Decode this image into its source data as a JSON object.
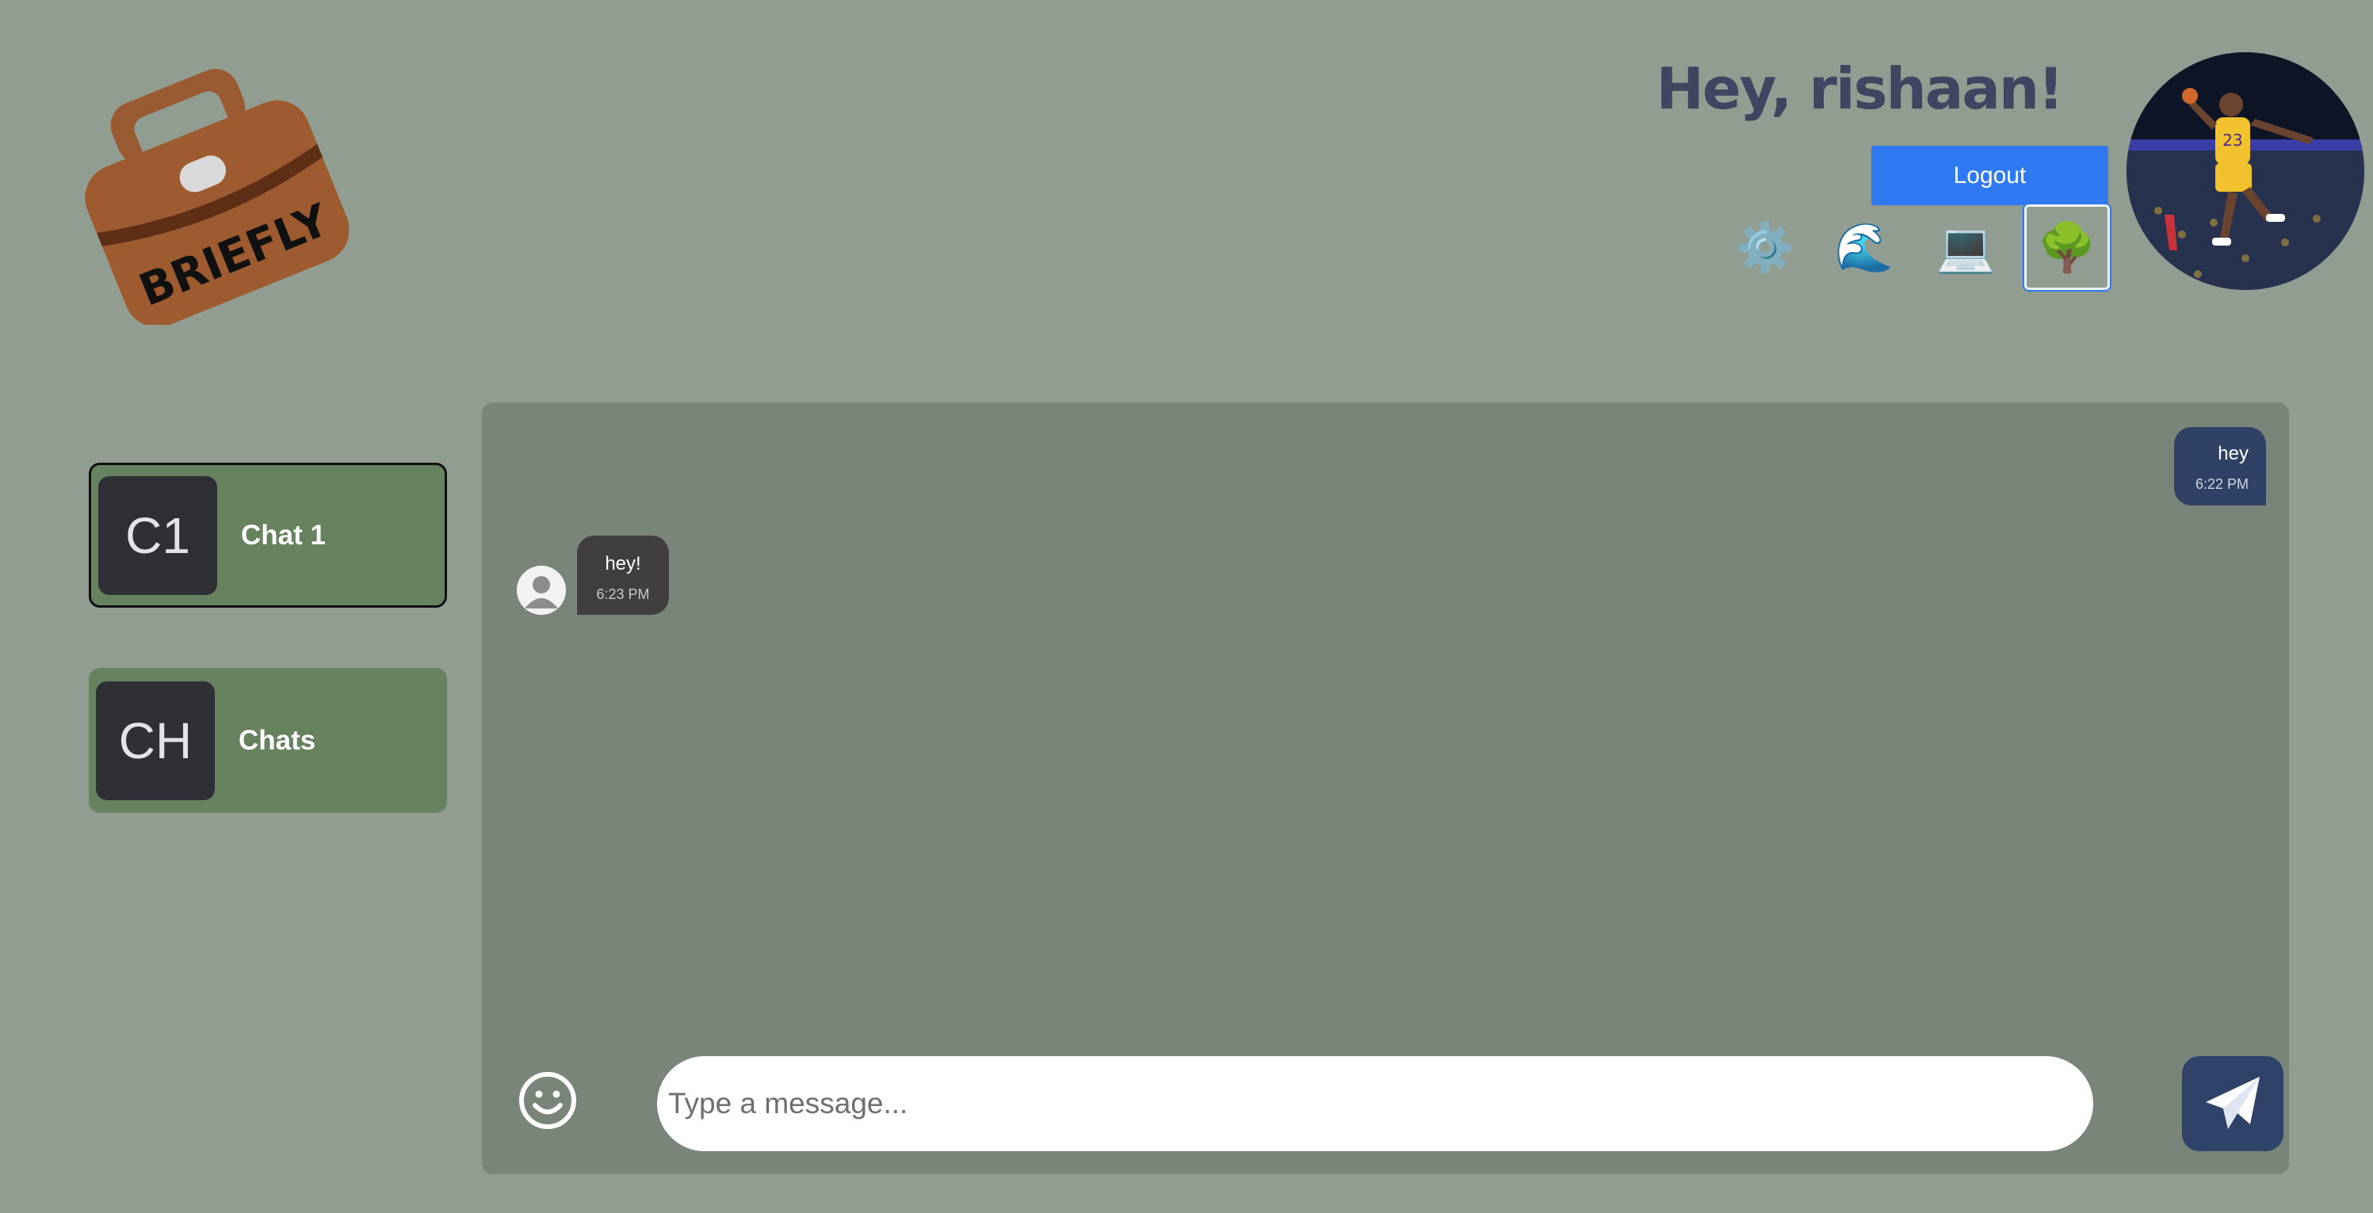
{
  "app": {
    "logo_text": "BRIEFLY"
  },
  "header": {
    "greeting": "Hey, rishaan!",
    "logout_label": "Logout",
    "themes": [
      {
        "icon": "gear-icon",
        "glyph": "⚙️",
        "selected": false
      },
      {
        "icon": "wave-icon",
        "glyph": "🌊",
        "selected": false
      },
      {
        "icon": "laptop-icon",
        "glyph": "💻",
        "selected": false
      },
      {
        "icon": "tree-icon",
        "glyph": "🌳",
        "selected": true
      }
    ]
  },
  "sidebar": {
    "chats": [
      {
        "badge": "C1",
        "name": "Chat 1",
        "active": true
      },
      {
        "badge": "CH",
        "name": "Chats",
        "active": false
      }
    ]
  },
  "messages": [
    {
      "direction": "outgoing",
      "text": "hey",
      "time": "6:22 PM"
    },
    {
      "direction": "incoming",
      "text": "hey!",
      "time": "6:23 PM"
    }
  ],
  "composer": {
    "placeholder": "Type a message...",
    "value": ""
  },
  "colors": {
    "page_bg": "#919d90",
    "chat_panel_bg": "#7a8579",
    "card_bg": "#66825f",
    "badge_bg": "#2f3036",
    "logout_blue": "#2f79f3",
    "outgoing_bubble": "#2f4266",
    "incoming_bubble": "#403f3d",
    "send_button": "#2e4367",
    "greeting_text": "#3e4662"
  }
}
